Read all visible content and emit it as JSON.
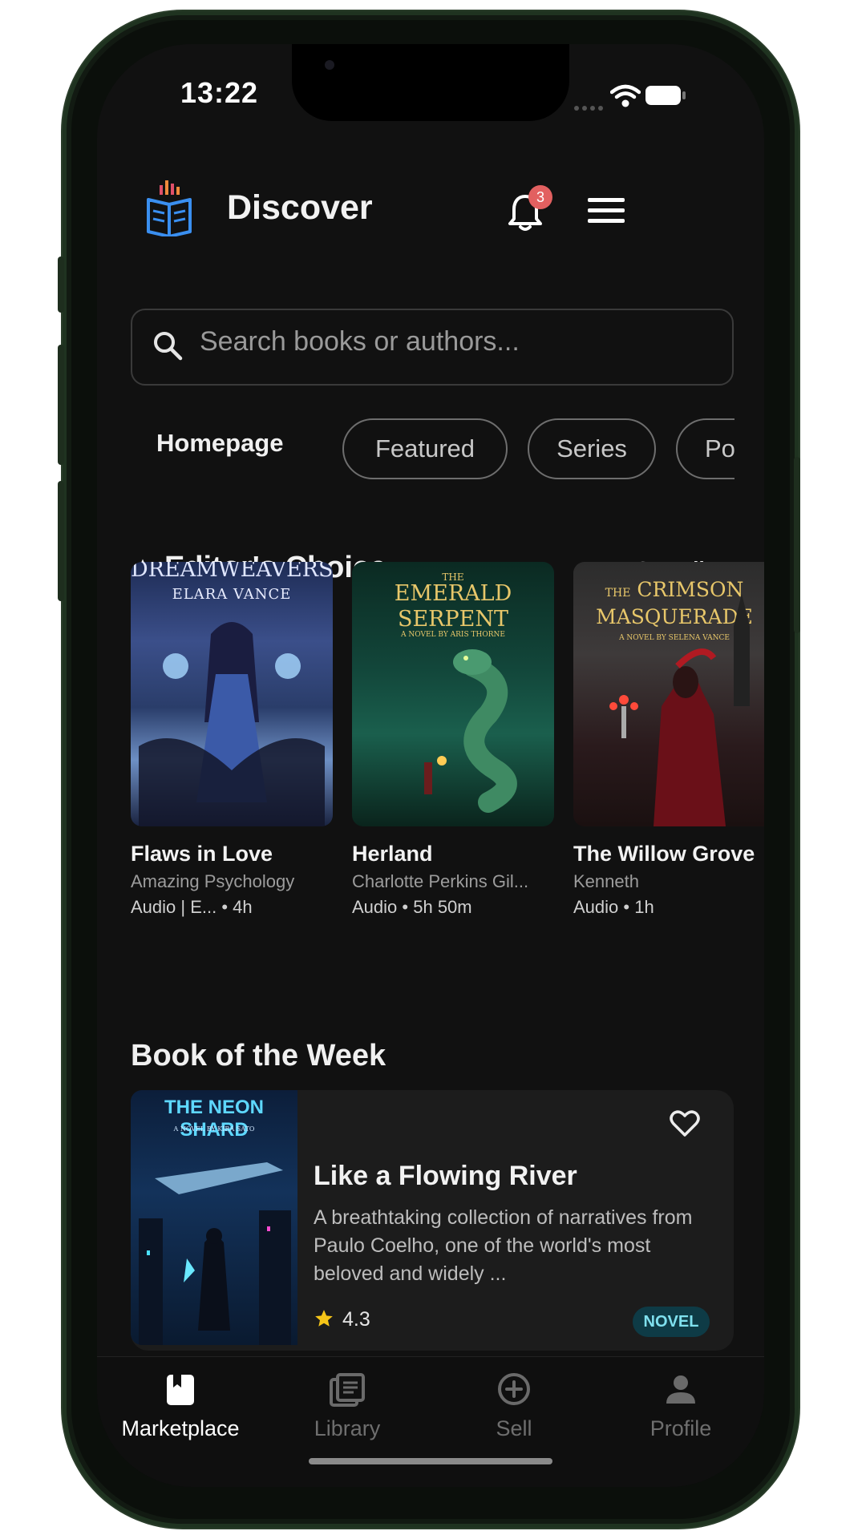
{
  "status_bar": {
    "time": "13:22"
  },
  "header": {
    "title": "Discover",
    "notification_count": "3"
  },
  "search": {
    "placeholder": "Search books or authors..."
  },
  "tabs": {
    "active": "Homepage",
    "chips": [
      "Featured",
      "Series",
      "Po"
    ]
  },
  "editors_choice": {
    "title": "Editor's Choice",
    "see_all": "See All",
    "books": [
      {
        "cover_title": "DREAMWEAVERS",
        "cover_author": "ELARA VANCE",
        "title": "Flaws in Love",
        "author": "Amazing Psychology",
        "format": "Audio | E...",
        "duration": "4h"
      },
      {
        "cover_title": "EMERALD SERPENT",
        "cover_prefix": "THE",
        "cover_subtitle": "A NOVEL BY ARIS THORNE",
        "title": "Herland",
        "author": "Charlotte Perkins Gil...",
        "format": "Audio",
        "duration": "5h 50m"
      },
      {
        "cover_title": "CRIMSON MASQUERADE",
        "cover_prefix": "THE",
        "cover_subtitle": "A NOVEL BY SELENA VANCE",
        "title": "The Willow Grove",
        "author": "Kenneth",
        "format": "Audio",
        "duration": "1h"
      }
    ]
  },
  "book_of_week": {
    "section_title": "Book of the Week",
    "cover_title": "THE NEON SHARD",
    "cover_subtitle": "A NOVEL BY KIRA SATO",
    "title": "Like a Flowing River",
    "description": "A breathtaking collection of narratives from Paulo Coelho, one of the world's most beloved and widely ...",
    "rating": "4.3",
    "badge": "NOVEL"
  },
  "bottom_nav": {
    "items": [
      {
        "label": "Marketplace",
        "icon": "bookmark-book-icon",
        "active": true
      },
      {
        "label": "Library",
        "icon": "library-icon",
        "active": false
      },
      {
        "label": "Sell",
        "icon": "add-circle-icon",
        "active": false
      },
      {
        "label": "Profile",
        "icon": "person-icon",
        "active": false
      }
    ]
  },
  "colors": {
    "background": "#111111",
    "badge": "#e05555",
    "accent": "#0e3b46",
    "star": "#f5c518"
  }
}
